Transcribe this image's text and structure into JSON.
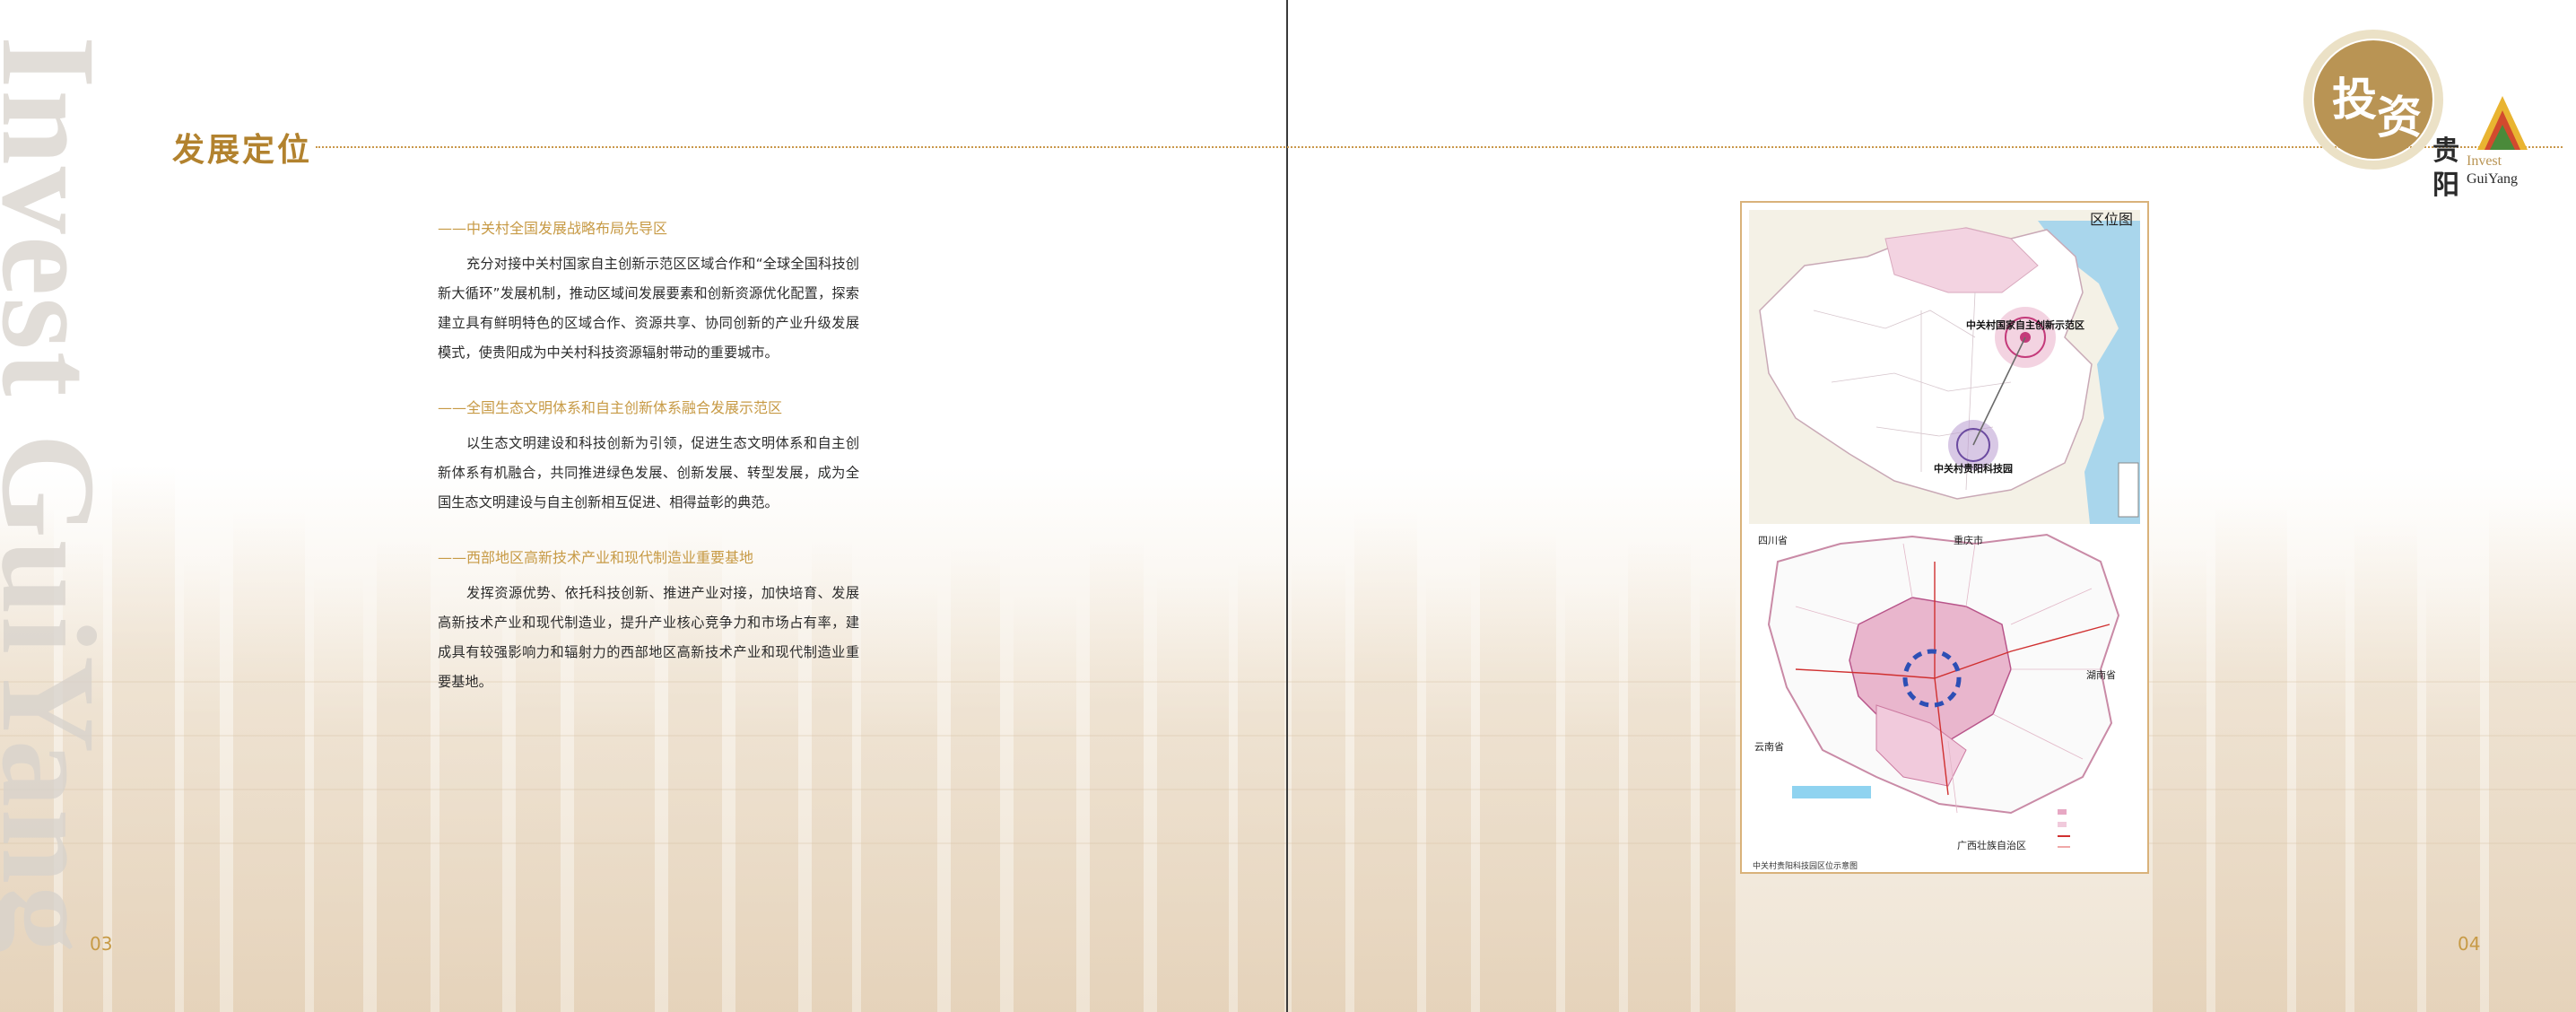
{
  "side_title": "Invest GuiYang",
  "section": {
    "heading": "发展定位"
  },
  "items": [
    {
      "title": "——中关村全国发展战略布局先导区",
      "text": "充分对接中关村国家自主创新示范区区域合作和“全球全国科技创新大循环”发展机制，推动区域间发展要素和创新资源优化配置，探索建立具有鲜明特色的区域合作、资源共享、协同创新的产业升级发展模式，使贵阳成为中关村科技资源辐射带动的重要城市。"
    },
    {
      "title": "——全国生态文明体系和自主创新体系融合发展示范区",
      "text": "以生态文明建设和科技创新为引领，促进生态文明体系和自主创新体系有机融合，共同推进绿色发展、创新发展、转型发展，成为全国生态文明建设与自主创新相互促进、相得益彰的典范。"
    },
    {
      "title": "——西部地区高新技术产业和现代制造业重要基地",
      "text": "发挥资源优势、依托科技创新、推进产业对接，加快培育、发展高新技术产业和现代制造业，提升产业核心竞争力和市场占有率，建成具有较强影响力和辐射力的西部地区高新技术产业和现代制造业重要基地。"
    }
  ],
  "page_numbers": {
    "left": "03",
    "right": "04"
  },
  "map": {
    "top_title": "区位图",
    "label_beijing": "中关村国家自主创新示范区",
    "label_guiyang": "中关村贵阳科技园",
    "province_labels": {
      "sichuan": "四川省",
      "chongqing": "重庆市",
      "hunan": "湖南省",
      "yunnan": "云南省",
      "guangxi": "广西壮族自治区"
    },
    "caption": "中关村贵阳科技园区位示意图"
  },
  "logo": {
    "char1": "投",
    "char2": "资",
    "vchar1": "贵",
    "vchar2": "阳",
    "en1": "Invest",
    "en2": "GuiYang"
  },
  "colors": {
    "accent": "#b2822e",
    "accent_light": "#c79a45",
    "text": "#2b2b2b",
    "map_pink": "#e7a8c4",
    "map_sea": "#9fd1ea"
  }
}
